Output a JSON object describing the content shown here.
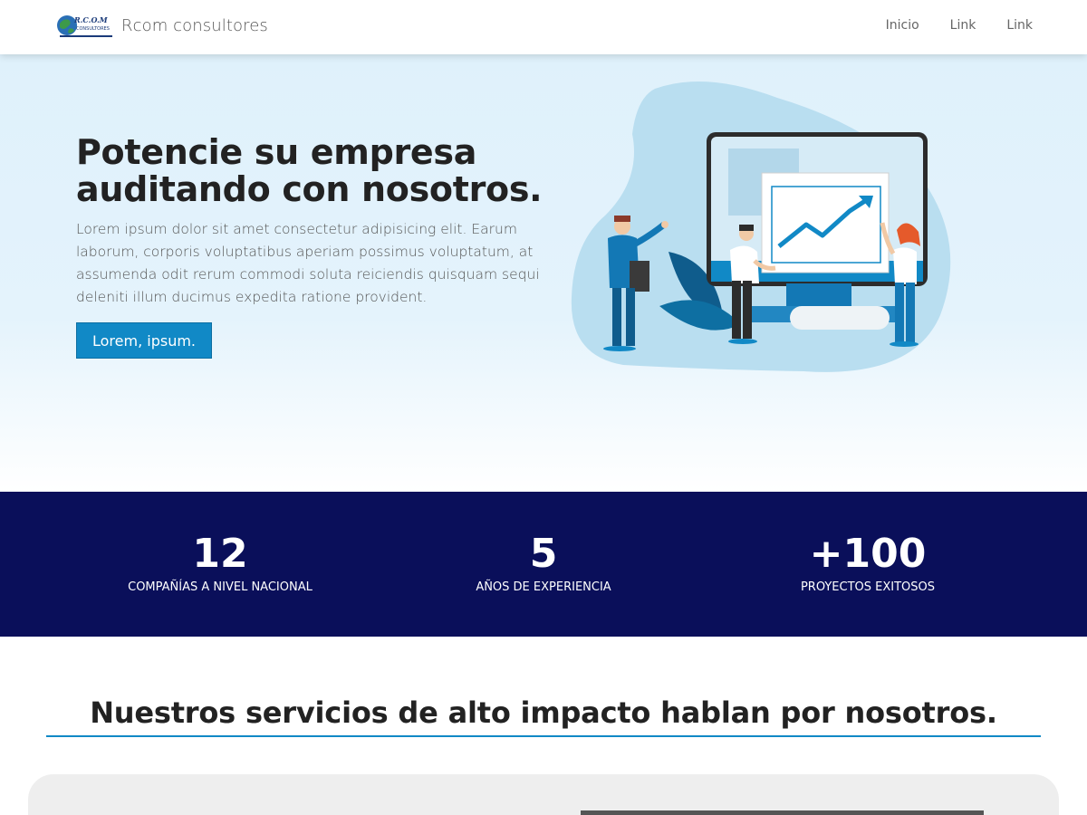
{
  "navbar": {
    "brand": "Rcom consultores",
    "logo_text": "R.C.O.M. CONSULTORES",
    "links": [
      "Inicio",
      "Link",
      "Link"
    ]
  },
  "hero": {
    "title": "Potencie su empresa auditando con nosotros.",
    "text": "Lorem ipsum dolor sit amet consectetur adipisicing elit. Earum laborum, corporis voluptatibus aperiam possimus voluptatum, at assumenda odit rerum commodi soluta reiciendis quisquam sequi deleniti illum ducimus expedita ratione provident.",
    "button_label": "Lorem, ipsum."
  },
  "stats": [
    {
      "number": "12",
      "label": "COMPAÑÍAS A NIVEL NACIONAL"
    },
    {
      "number": "5",
      "label": "AÑOS DE EXPERIENCIA"
    },
    {
      "number": "+100",
      "label": "PROYECTOS EXITOSOS"
    }
  ],
  "services": {
    "title": "Nuestros servicios de alto impacto hablan por nosotros."
  },
  "colors": {
    "accent": "#1189c6",
    "stats_bg": "#0a0f5a",
    "hero_bg": "#dff1fb",
    "card_bg": "#eeeeee"
  }
}
